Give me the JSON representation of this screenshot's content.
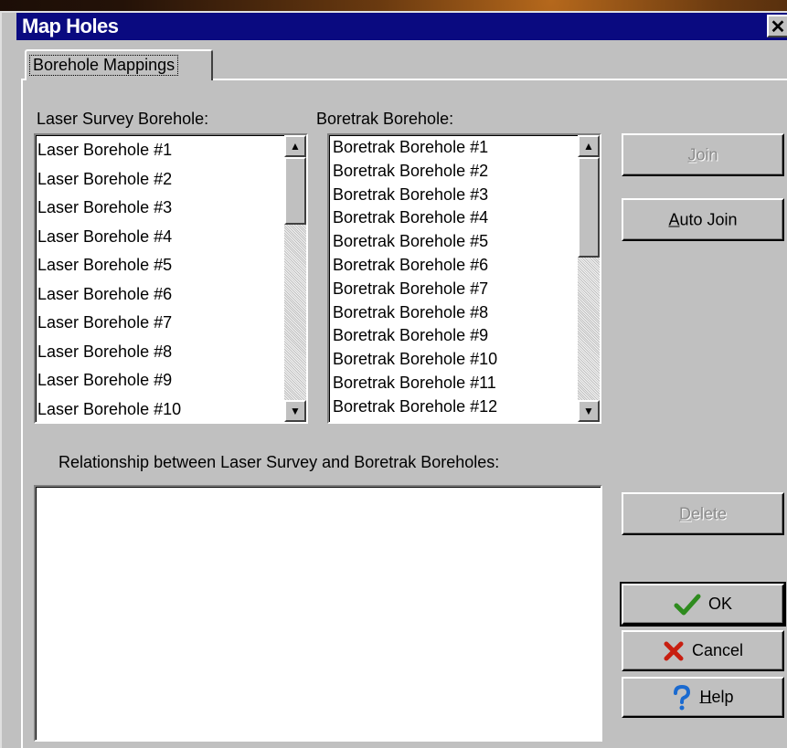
{
  "window": {
    "title": "Map Holes",
    "close_glyph": "✕"
  },
  "tabs": [
    {
      "label": "Borehole Mappings"
    }
  ],
  "laser_list": {
    "label": "Laser Survey Borehole:",
    "items": [
      "Laser Borehole #1",
      "Laser Borehole #2",
      "Laser Borehole #3",
      "Laser Borehole #4",
      "Laser Borehole #5",
      "Laser Borehole #6",
      "Laser Borehole #7",
      "Laser Borehole #8",
      "Laser Borehole #9",
      "Laser Borehole #10"
    ]
  },
  "boretrak_list": {
    "label": "Boretrak Borehole:",
    "items": [
      "Boretrak Borehole #1",
      "Boretrak Borehole #2",
      "Boretrak Borehole #3",
      "Boretrak Borehole #4",
      "Boretrak Borehole #5",
      "Boretrak Borehole #6",
      "Boretrak Borehole #7",
      "Boretrak Borehole #8",
      "Boretrak Borehole #9",
      "Boretrak Borehole #10",
      "Boretrak Borehole #11",
      "Boretrak Borehole #12"
    ]
  },
  "relationship": {
    "label": "Relationship between Laser Survey and Boretrak Boreholes:"
  },
  "buttons": {
    "join": {
      "mnemonic": "J",
      "rest": "oin",
      "enabled": false
    },
    "auto_join": {
      "mnemonic": "A",
      "rest": "uto Join",
      "enabled": true
    },
    "delete": {
      "mnemonic": "D",
      "rest": "elete",
      "enabled": false
    },
    "ok": {
      "label": "OK",
      "icon": "check-icon",
      "color": "#2e8b1e"
    },
    "cancel": {
      "label": "Cancel",
      "icon": "x-icon",
      "color": "#c81e10"
    },
    "help": {
      "mnemonic": "H",
      "rest": "elp",
      "icon": "question-icon",
      "color": "#1a6ad0"
    }
  },
  "scroll": {
    "up_glyph": "▲",
    "down_glyph": "▼"
  }
}
